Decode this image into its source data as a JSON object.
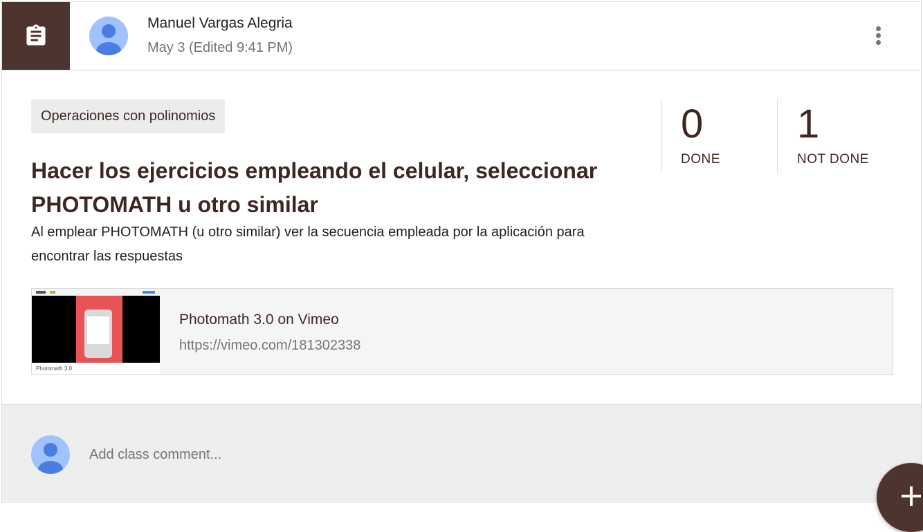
{
  "post": {
    "author": "Manuel Vargas Alegria",
    "timestamp": "May 3 (Edited 9:41 PM)",
    "type_icon": "assignment-icon",
    "menu_icon": "more-vert-icon"
  },
  "assignment": {
    "topic": "Operaciones con polinomios",
    "title": "Hacer los ejercicios empleando el celular, seleccionar PHOTOMATH u otro similar",
    "description": "Al emplear PHOTOMATH (u otro similar) ver la secuencia empleada por la aplicación para encontrar las respuestas"
  },
  "stats": {
    "done": {
      "count": "0",
      "label": "DONE"
    },
    "not_done": {
      "count": "1",
      "label": "NOT DONE"
    }
  },
  "attachment": {
    "title": "Photomath 3.0 on Vimeo",
    "url": "https://vimeo.com/181302338",
    "thumbnail_caption": "Photomath 3.0"
  },
  "comments": {
    "placeholder": "Add class comment..."
  },
  "fab": {
    "icon": "plus-icon"
  },
  "colors": {
    "accent": "#4e342e",
    "avatar": "#a0c3ff",
    "avatar_figure": "#4a7de0"
  }
}
